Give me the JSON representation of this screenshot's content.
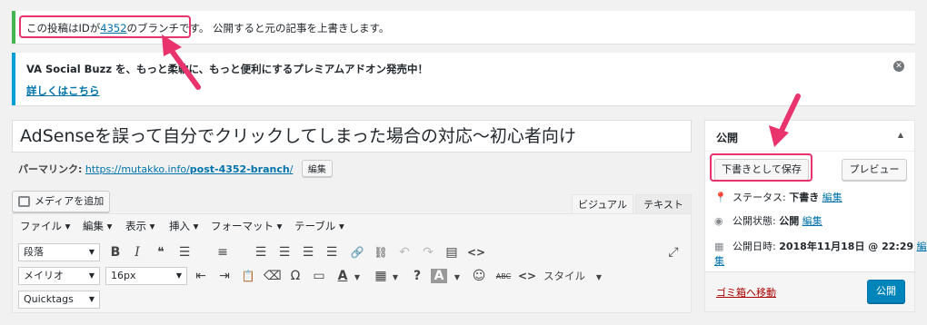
{
  "notices": {
    "branch_prefix": "この投稿はIDが",
    "branch_id": "4352",
    "branch_suffix": "のブランチです。",
    "branch_rest": "公開すると元の記事を上書きします。",
    "promo_text": "VA Social Buzz を、もっと柔軟に、もっと便利にするプレミアムアドオン発売中！",
    "promo_link": "詳しくはこちら"
  },
  "post": {
    "title": "AdSenseを誤って自分でクリックしてしまった場合の対応〜初心者向け",
    "permalink_label": "パーマリンク:",
    "permalink_base": "https://mutakko.info/",
    "permalink_slug": "post-4352-branch",
    "permalink_trail": "/",
    "edit_label": "編集"
  },
  "editor": {
    "media_button": "メディアを追加",
    "tab_visual": "ビジュアル",
    "tab_text": "テキスト",
    "menu": [
      "ファイル ▾",
      "編集 ▾",
      "表示 ▾",
      "挿入 ▾",
      "フォーマット ▾",
      "テーブル ▾"
    ],
    "format_select": "段落",
    "font_select": "メイリオ",
    "size_select": "16px",
    "style_label": "スタイル",
    "quicktags": "Quicktags",
    "toolbar1": [
      "B",
      "I",
      "❝",
      "☰",
      "≡",
      "☰",
      "☰",
      "☰",
      "☰",
      "🔗",
      "⛓",
      "↶",
      "↷",
      "▤",
      "<>"
    ],
    "toolbar2": [
      "⇤",
      "⇥",
      "📋",
      "⌫",
      "Ω",
      "▭",
      "A",
      "▦",
      "?",
      "A",
      "☺",
      "ABC",
      "<>"
    ],
    "fullscreen": "⤢"
  },
  "publish": {
    "heading": "公開",
    "save_draft": "下書きとして保存",
    "preview": "プレビュー",
    "status_label": "ステータス:",
    "status_value": "下書き",
    "visibility_label": "公開状態:",
    "visibility_value": "公開",
    "date_label": "公開日時:",
    "date_value": "2018年11月18日 @ 22:29",
    "edit": "編集",
    "edit_split1": "編",
    "edit_split2": "集",
    "trash": "ゴミ箱へ移動",
    "publish_button": "公開"
  },
  "colors": {
    "annotation": "#e8336d",
    "link": "#0073aa",
    "primary": "#0085ba",
    "success": "#46b450",
    "info": "#00a0d2"
  }
}
